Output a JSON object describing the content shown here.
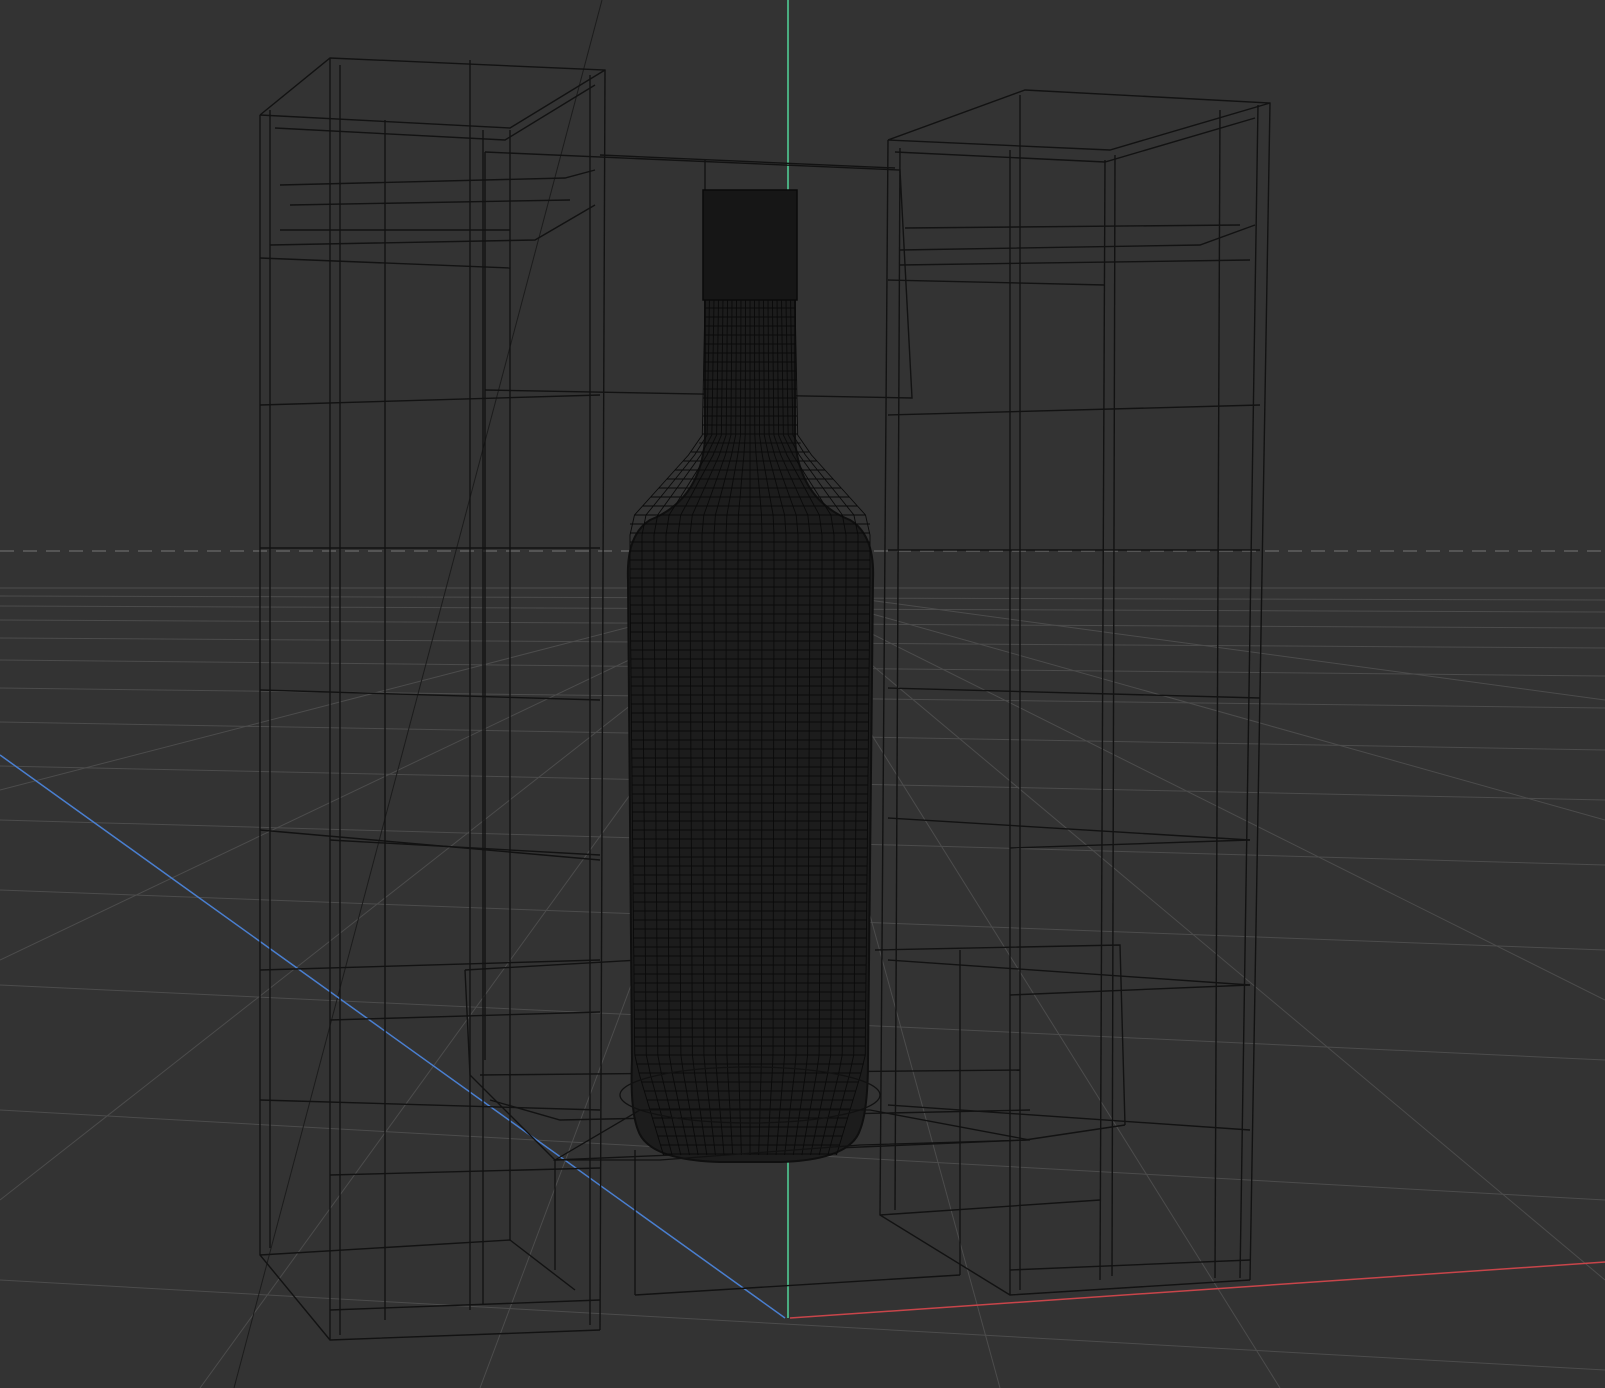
{
  "viewport": {
    "background": "#333333",
    "grid_color": "#5a5a5a",
    "wire_color": "#121212",
    "axes": {
      "x_color": "#c8454a",
      "y_color": "#52d49a",
      "z_color": "#4a7fd0"
    }
  },
  "objects": [
    {
      "icon": "display-box-wireframe-icon"
    },
    {
      "icon": "bottle-wireframe-icon"
    }
  ]
}
